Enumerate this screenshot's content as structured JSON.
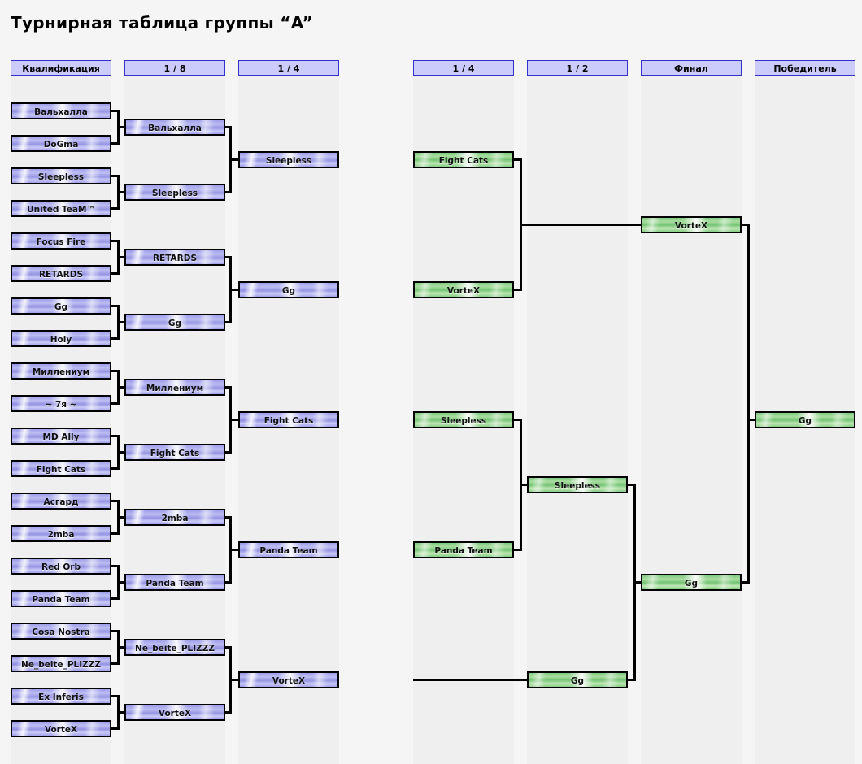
{
  "page": {
    "title": "Турнирная таблица группы “A”",
    "accent_header_bg": "#ccccfc",
    "accent_header_border": "#3333cc",
    "team_blue": "#9a9ae8",
    "team_green": "#7fc97f",
    "column_strip_bg": "#efefef",
    "page_bg": "#f5f5f5"
  },
  "rounds": [
    {
      "id": "qualification",
      "label": "Квалификация"
    },
    {
      "id": "round-of-16",
      "label": "1 / 8"
    },
    {
      "id": "quarter-left",
      "label": "1 / 4"
    },
    {
      "id": "quarter-right",
      "label": "1 / 4"
    },
    {
      "id": "semifinal",
      "label": "1 / 2"
    },
    {
      "id": "final",
      "label": "Финал"
    },
    {
      "id": "winner",
      "label": "Победитель"
    }
  ],
  "qualification": [
    {
      "name": "Вальхалла"
    },
    {
      "name": "DoGma"
    },
    {
      "name": "Sleepless"
    },
    {
      "name": "United TeaM™"
    },
    {
      "name": "Focus Fire"
    },
    {
      "name": "RETARDS"
    },
    {
      "name": "Gg"
    },
    {
      "name": "Holy"
    },
    {
      "name": "Миллениум"
    },
    {
      "name": "~ 7я ~"
    },
    {
      "name": "MD Ally"
    },
    {
      "name": "Fight Cats"
    },
    {
      "name": "Асгард"
    },
    {
      "name": "2mba"
    },
    {
      "name": "Red Orb"
    },
    {
      "name": "Panda Team"
    },
    {
      "name": "Cosa Nostra"
    },
    {
      "name": "Ne_beite_PLIZZZ"
    },
    {
      "name": "Ex Inferis"
    },
    {
      "name": "VorteX"
    }
  ],
  "round_of_16": [
    {
      "name": "Вальхалла"
    },
    {
      "name": "Sleepless"
    },
    {
      "name": "RETARDS"
    },
    {
      "name": "Gg"
    },
    {
      "name": "Миллениум"
    },
    {
      "name": "Fight Cats"
    },
    {
      "name": "2mba"
    },
    {
      "name": "Panda Team"
    },
    {
      "name": "Ne_beite_PLIZZZ"
    },
    {
      "name": "VorteX"
    }
  ],
  "quarter_left": [
    {
      "name": "Sleepless"
    },
    {
      "name": "Gg"
    },
    {
      "name": "Fight Cats"
    },
    {
      "name": "Panda Team"
    },
    {
      "name": "VorteX"
    }
  ],
  "quarter_right": [
    {
      "name": "Fight Cats"
    },
    {
      "name": "VorteX"
    },
    {
      "name": "Sleepless"
    },
    {
      "name": "Panda Team"
    }
  ],
  "semifinal": [
    {
      "name": "Sleepless"
    },
    {
      "name": "Gg"
    }
  ],
  "final": [
    {
      "name": "VorteX"
    },
    {
      "name": "Gg"
    }
  ],
  "winner": [
    {
      "name": "Gg"
    }
  ]
}
